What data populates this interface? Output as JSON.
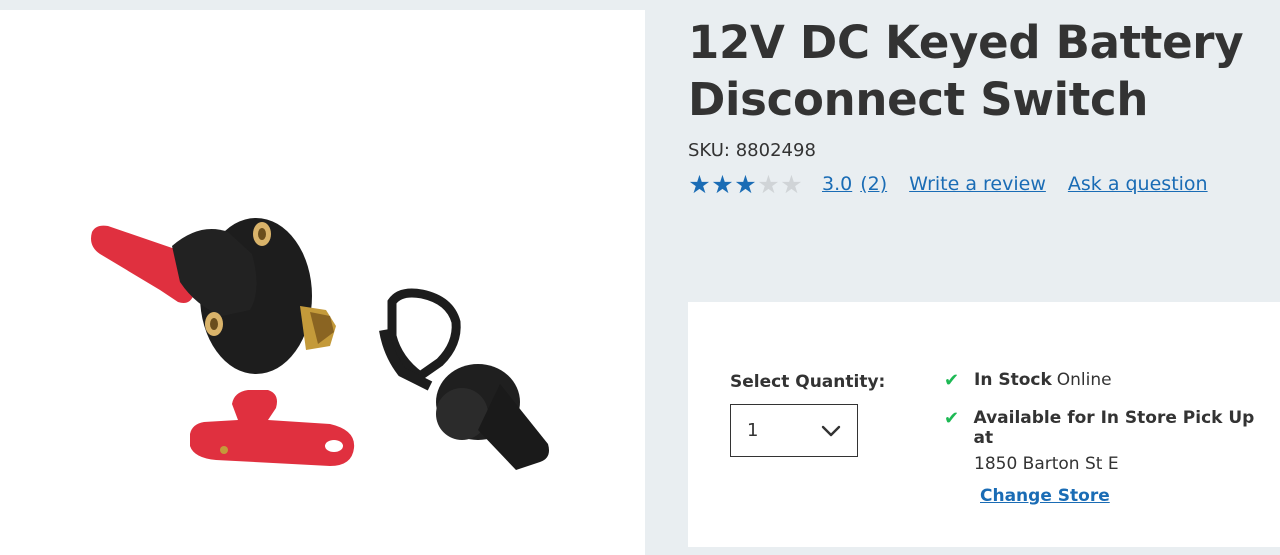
{
  "product": {
    "title": "12V DC Keyed Battery Disconnect Switch",
    "sku_label": "SKU:",
    "sku": "8802498",
    "rating": {
      "value": "3.0",
      "count": "(2)",
      "stars_filled": 3,
      "stars_total": 5
    },
    "write_review": "Write a review",
    "ask_question": "Ask a question"
  },
  "purchase": {
    "qty_label": "Select Quantity:",
    "qty_value": "1",
    "stock": {
      "online_bold": "In Stock",
      "online_rest": "Online",
      "pickup_bold": "Available for In Store Pick Up at",
      "store_address": "1850 Barton St E",
      "change_store": "Change Store"
    }
  },
  "colors": {
    "accent": "#1a6cb5",
    "check": "#1db954",
    "page_bg": "#e9eef1"
  }
}
